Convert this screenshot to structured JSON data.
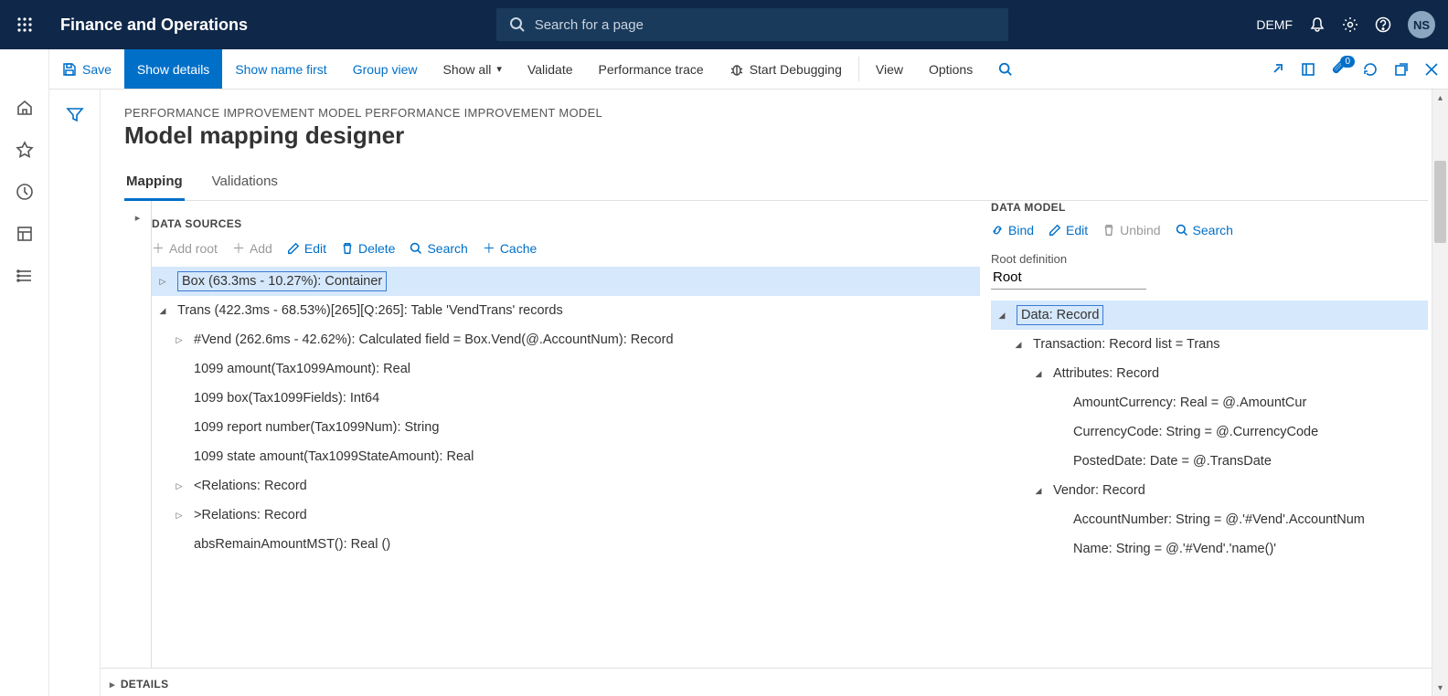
{
  "header": {
    "app_title": "Finance and Operations",
    "search_placeholder": "Search for a page",
    "company": "DEMF",
    "user_initials": "NS"
  },
  "action_bar": {
    "save": "Save",
    "show_details": "Show details",
    "show_name_first": "Show name first",
    "group_view": "Group view",
    "show_all": "Show all",
    "validate": "Validate",
    "performance_trace": "Performance trace",
    "start_debugging": "Start Debugging",
    "view": "View",
    "options": "Options",
    "attachments_count": "0"
  },
  "page": {
    "breadcrumb": "PERFORMANCE IMPROVEMENT MODEL PERFORMANCE IMPROVEMENT MODEL",
    "title": "Model mapping designer",
    "tabs": {
      "mapping": "Mapping",
      "validations": "Validations"
    }
  },
  "data_sources": {
    "heading": "DATA SOURCES",
    "buttons": {
      "add_root": "Add root",
      "add": "Add",
      "edit": "Edit",
      "delete": "Delete",
      "search": "Search",
      "cache": "Cache"
    },
    "tree": [
      {
        "indent": 0,
        "twisty": "right",
        "selected": true,
        "label": "Box (63.3ms - 10.27%): Container"
      },
      {
        "indent": 0,
        "twisty": "down",
        "selected": false,
        "label": "Trans (422.3ms - 68.53%)[265][Q:265]: Table 'VendTrans' records"
      },
      {
        "indent": 1,
        "twisty": "right",
        "selected": false,
        "label": "#Vend (262.6ms - 42.62%): Calculated field = Box.Vend(@.AccountNum): Record"
      },
      {
        "indent": 1,
        "twisty": "",
        "selected": false,
        "label": "1099 amount(Tax1099Amount): Real"
      },
      {
        "indent": 1,
        "twisty": "",
        "selected": false,
        "label": "1099 box(Tax1099Fields): Int64"
      },
      {
        "indent": 1,
        "twisty": "",
        "selected": false,
        "label": "1099 report number(Tax1099Num): String"
      },
      {
        "indent": 1,
        "twisty": "",
        "selected": false,
        "label": "1099 state amount(Tax1099StateAmount): Real"
      },
      {
        "indent": 1,
        "twisty": "right",
        "selected": false,
        "label": "<Relations: Record"
      },
      {
        "indent": 1,
        "twisty": "right",
        "selected": false,
        "label": ">Relations: Record"
      },
      {
        "indent": 1,
        "twisty": "",
        "selected": false,
        "label": "absRemainAmountMST(): Real ()"
      }
    ]
  },
  "data_model": {
    "heading": "DATA MODEL",
    "buttons": {
      "bind": "Bind",
      "edit": "Edit",
      "unbind": "Unbind",
      "search": "Search"
    },
    "root_def_label": "Root definition",
    "root_def_value": "Root",
    "tree": [
      {
        "indent": 0,
        "twisty": "down",
        "selected": true,
        "label": "Data: Record"
      },
      {
        "indent": 1,
        "twisty": "down",
        "selected": false,
        "label": "Transaction: Record list = Trans"
      },
      {
        "indent": 2,
        "twisty": "down",
        "selected": false,
        "label": "Attributes: Record"
      },
      {
        "indent": 3,
        "twisty": "",
        "selected": false,
        "label": "AmountCurrency: Real = @.AmountCur"
      },
      {
        "indent": 3,
        "twisty": "",
        "selected": false,
        "label": "CurrencyCode: String = @.CurrencyCode"
      },
      {
        "indent": 3,
        "twisty": "",
        "selected": false,
        "label": "PostedDate: Date = @.TransDate"
      },
      {
        "indent": 2,
        "twisty": "down",
        "selected": false,
        "label": "Vendor: Record"
      },
      {
        "indent": 3,
        "twisty": "",
        "selected": false,
        "label": "AccountNumber: String = @.'#Vend'.AccountNum"
      },
      {
        "indent": 3,
        "twisty": "",
        "selected": false,
        "label": "Name: String = @.'#Vend'.'name()'"
      }
    ]
  },
  "details": {
    "heading": "DETAILS"
  }
}
